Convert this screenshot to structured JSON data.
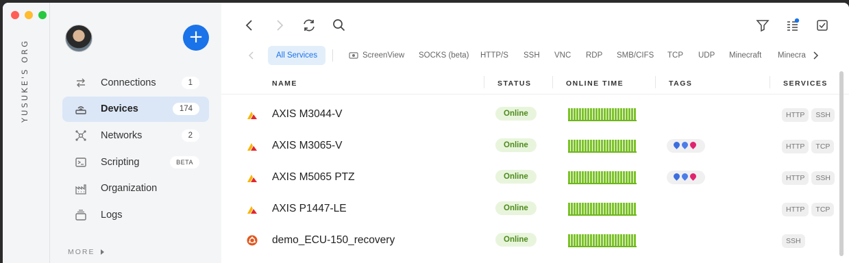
{
  "org": {
    "name": "YUSUKE'S ORG"
  },
  "colors": {
    "accent": "#1a73e8",
    "online": "#7cc22a",
    "close": "#ff5f57",
    "min": "#febc2e",
    "max": "#28c840"
  },
  "sidebar": {
    "add_label": "+",
    "items": [
      {
        "label": "Connections",
        "badge": "1",
        "icon": "arrows-swap-icon"
      },
      {
        "label": "Devices",
        "badge": "174",
        "icon": "router-icon",
        "active": true
      },
      {
        "label": "Networks",
        "badge": "2",
        "icon": "network-icon"
      },
      {
        "label": "Scripting",
        "badge": "BETA",
        "icon": "terminal-icon"
      },
      {
        "label": "Organization",
        "badge": "",
        "icon": "building-icon"
      },
      {
        "label": "Logs",
        "badge": "",
        "icon": "logs-icon"
      }
    ],
    "more_label": "MORE"
  },
  "toolbar": {
    "icons": [
      "back-icon",
      "forward-icon",
      "refresh-icon",
      "search-icon",
      "filter-icon",
      "columns-icon",
      "select-icon"
    ]
  },
  "tabs": [
    "All Services",
    "ScreenView",
    "SOCKS (beta)",
    "HTTP/S",
    "SSH",
    "VNC",
    "RDP",
    "SMB/CIFS",
    "TCP",
    "UDP",
    "Minecraft",
    "Minecra"
  ],
  "columns": {
    "name": "NAME",
    "status": "STATUS",
    "online_time": "ONLINE TIME",
    "tags": "TAGS",
    "services": "SERVICES"
  },
  "devices": [
    {
      "name": "AXIS M3044-V",
      "status": "Online",
      "icon": "axis-logo-icon",
      "has_tags": false,
      "services": [
        "HTTP",
        "SSH"
      ]
    },
    {
      "name": "AXIS M3065-V",
      "status": "Online",
      "icon": "axis-logo-icon",
      "has_tags": true,
      "services": [
        "HTTP",
        "TCP"
      ]
    },
    {
      "name": "AXIS M5065 PTZ",
      "status": "Online",
      "icon": "axis-logo-icon",
      "has_tags": true,
      "services": [
        "HTTP",
        "SSH"
      ]
    },
    {
      "name": "AXIS P1447-LE",
      "status": "Online",
      "icon": "axis-logo-icon",
      "has_tags": false,
      "services": [
        "HTTP",
        "TCP"
      ]
    },
    {
      "name": "demo_ECU-150_recovery",
      "status": "Online",
      "icon": "ubuntu-logo-icon",
      "has_tags": false,
      "services": [
        "SSH"
      ]
    }
  ]
}
